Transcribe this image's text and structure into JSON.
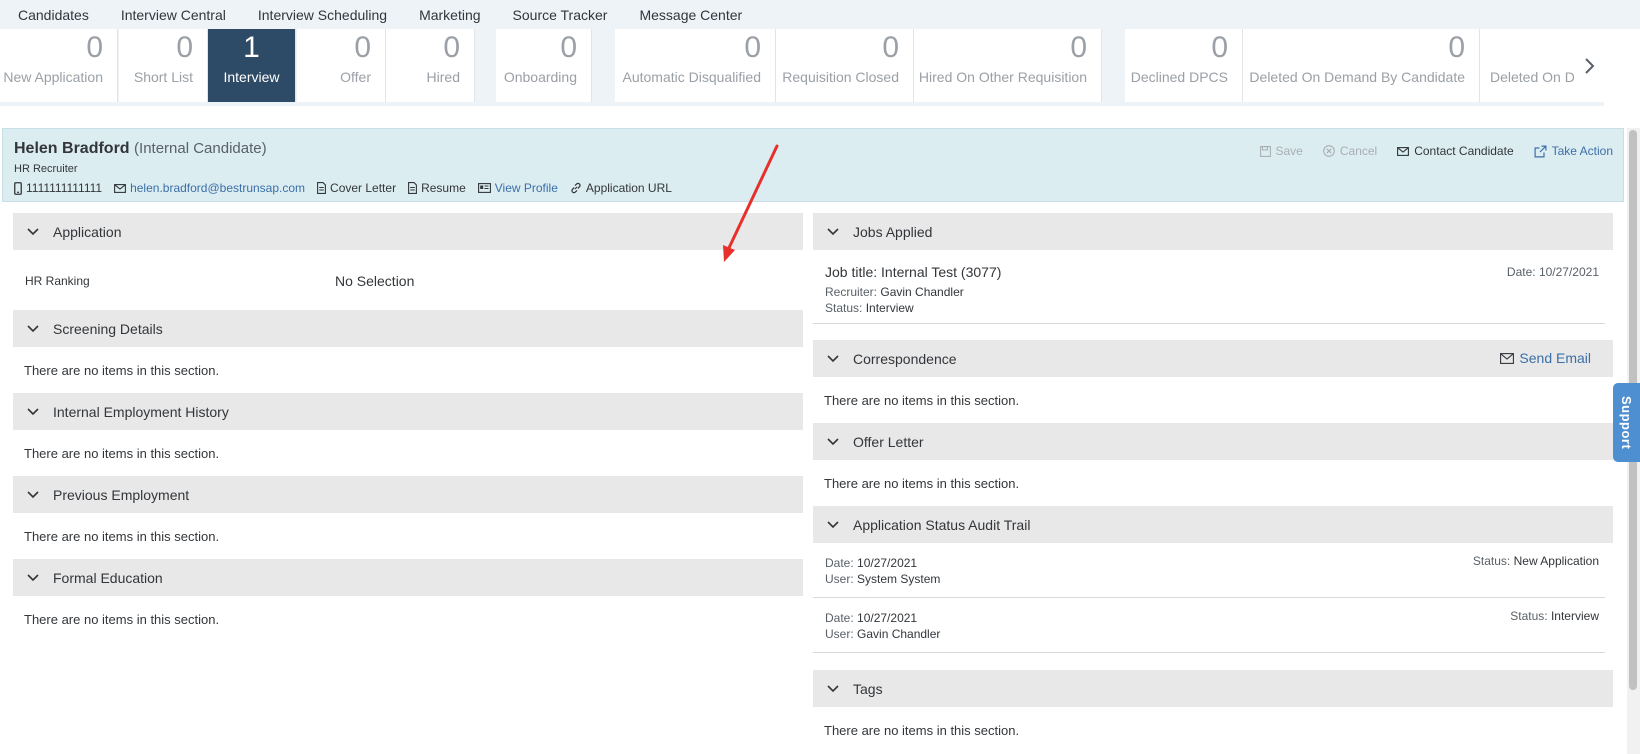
{
  "nav": {
    "items": [
      "Candidates",
      "Interview Central",
      "Interview Scheduling",
      "Marketing",
      "Source Tracker",
      "Message Center"
    ]
  },
  "pipeline": {
    "stages": [
      {
        "count": "0",
        "label": "New Application"
      },
      {
        "count": "0",
        "label": "Short List"
      },
      {
        "count": "1",
        "label": "Interview"
      },
      {
        "count": "0",
        "label": "Offer"
      },
      {
        "count": "0",
        "label": "Hired"
      },
      {
        "count": "0",
        "label": "Onboarding"
      },
      {
        "count": "0",
        "label": "Automatic Disqualified"
      },
      {
        "count": "0",
        "label": "Requisition Closed"
      },
      {
        "count": "0",
        "label": "Hired On Other Requisition"
      },
      {
        "count": "0",
        "label": "Declined DPCS"
      },
      {
        "count": "0",
        "label": "Deleted On Demand By Candidate"
      },
      {
        "count": "",
        "label": "Deleted On De"
      }
    ],
    "active_stage": "Interview"
  },
  "candidate": {
    "name": "Helen Bradford",
    "type": "(Internal Candidate)",
    "role": "HR Recruiter",
    "phone": "1111111111111",
    "email": "helen.bradford@bestrunsap.com",
    "cover_letter": "Cover Letter",
    "resume": "Resume",
    "view_profile": "View Profile",
    "application_url": "Application URL"
  },
  "actions": {
    "save": "Save",
    "cancel": "Cancel",
    "contact": "Contact Candidate",
    "take_action": "Take Action"
  },
  "left": {
    "application": {
      "title": "Application",
      "hr_ranking_label": "HR Ranking",
      "hr_ranking_value": "No Selection"
    },
    "screening": {
      "title": "Screening Details",
      "empty": "There are no items in this section."
    },
    "internal_history": {
      "title": "Internal Employment History",
      "empty": "There are no items in this section."
    },
    "previous": {
      "title": "Previous Employment",
      "empty": "There are no items in this section."
    },
    "education": {
      "title": "Formal Education",
      "empty": "There are no items in this section."
    }
  },
  "right": {
    "jobs": {
      "title": "Jobs Applied",
      "job_title": "Job title: Internal Test (3077)",
      "date_label": "Date:",
      "date": "10/27/2021",
      "recruiter_label": "Recruiter:",
      "recruiter": "Gavin Chandler",
      "status_label": "Status:",
      "status": "Interview"
    },
    "correspondence": {
      "title": "Correspondence",
      "send_email": "Send Email",
      "empty": "There are no items in this section."
    },
    "offer": {
      "title": "Offer Letter",
      "empty": "There are no items in this section."
    },
    "audit": {
      "title": "Application Status Audit Trail",
      "date_label": "Date:",
      "user_label": "User:",
      "status_label": "Status:",
      "entries": [
        {
          "date": "10/27/2021",
          "user": "System System",
          "status": "New Application"
        },
        {
          "date": "10/27/2021",
          "user": "Gavin Chandler",
          "status": "Interview"
        }
      ]
    },
    "tags": {
      "title": "Tags",
      "empty": "There are no items in this section."
    }
  },
  "support": {
    "label": "Support"
  },
  "colors": {
    "accent": "#2d4a66",
    "link": "#3b6fa7",
    "header_bg": "#dcedf2",
    "section_bg": "#e8e8e8",
    "annotation": "#e8302a"
  },
  "icons": [
    "phone-icon",
    "email-icon",
    "document-icon",
    "id-card-icon",
    "link-icon",
    "save-icon",
    "cancel-icon",
    "envelope-icon",
    "external-link-icon",
    "chevron-down-icon",
    "chevron-right-icon"
  ]
}
